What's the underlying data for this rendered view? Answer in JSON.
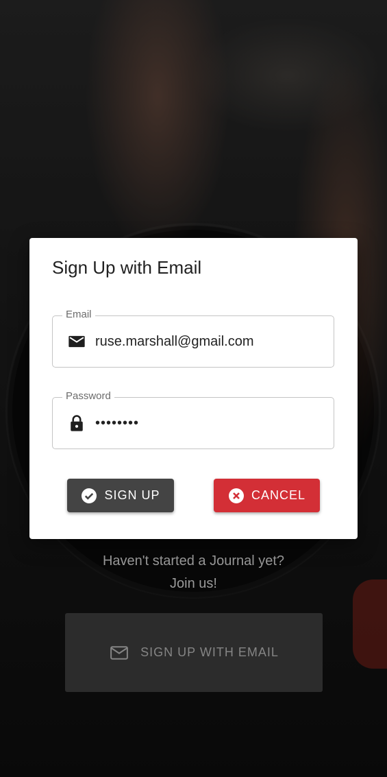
{
  "background": {
    "join_line1": "Haven't started a Journal yet?",
    "join_line2": "Join us!",
    "signup_email_button": {
      "label": "SIGN UP WITH EMAIL",
      "icon": "mail-outline-icon"
    }
  },
  "dialog": {
    "title": "Sign Up with Email",
    "email": {
      "label": "Email",
      "value": "ruse.marshall@gmail.com",
      "icon": "mail-icon"
    },
    "password": {
      "label": "Password",
      "value": "••••••••",
      "icon": "lock-icon"
    },
    "buttons": {
      "signup": {
        "label": "SIGN UP",
        "icon": "check-circle-icon",
        "color": "#444444"
      },
      "cancel": {
        "label": "CANCEL",
        "icon": "close-circle-icon",
        "color": "#d32f36"
      }
    }
  }
}
